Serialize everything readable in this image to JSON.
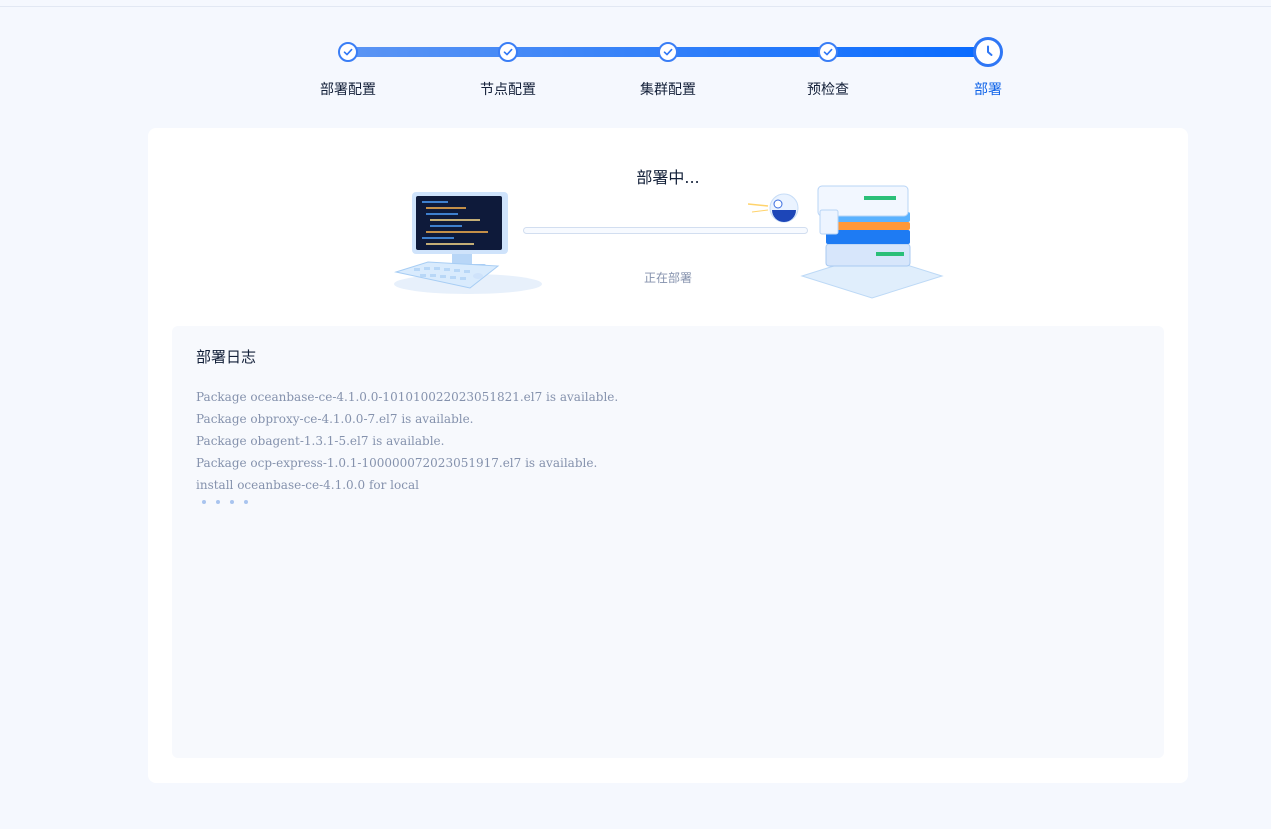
{
  "steps": [
    {
      "label": "部署配置",
      "state": "done"
    },
    {
      "label": "节点配置",
      "state": "done"
    },
    {
      "label": "集群配置",
      "state": "done"
    },
    {
      "label": "预检查",
      "state": "done"
    },
    {
      "label": "部署",
      "state": "current"
    }
  ],
  "deploy": {
    "title": "部署中...",
    "subtitle": "正在部署",
    "progress": 0
  },
  "log": {
    "title": "部署日志",
    "lines": [
      "Package oceanbase-ce-4.1.0.0-101010022023051821.el7 is available.",
      "Package obproxy-ce-4.1.0.0-7.el7 is available.",
      "Package obagent-1.3.1-5.el7 is available.",
      "Package ocp-express-1.0.1-100000072023051917.el7 is available.",
      "install oceanbase-ce-4.1.0.0 for local"
    ]
  },
  "colors": {
    "accent": "#0f63e8",
    "background": "#f5f8fe"
  }
}
